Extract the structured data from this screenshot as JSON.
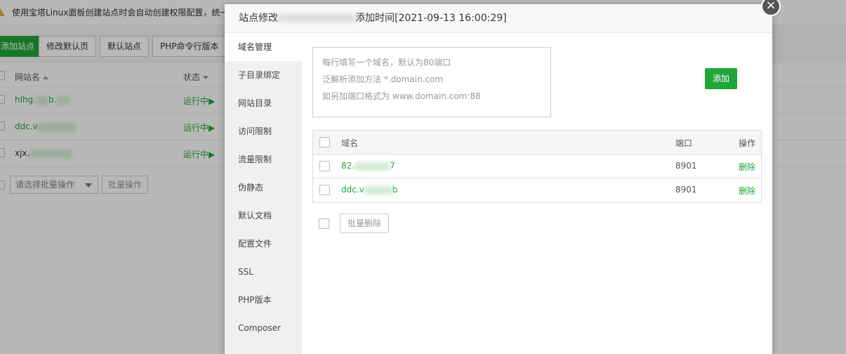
{
  "background": {
    "warning_text": "使用宝塔Linux面板创建站点时会自动创建权限配置，统一",
    "toolbar": {
      "add_site": "添加站点",
      "modify_default_page": "修改默认页",
      "default_site": "默认站点",
      "php_cli_version": "PHP命令行版本"
    },
    "table": {
      "col_name": "网站名",
      "col_status": "状态",
      "rows": [
        {
          "name_prefix": "hlhg.",
          "name_suffix": "b.",
          "status": "运行中▶"
        },
        {
          "name_prefix": "ddc.v",
          "name_suffix": "",
          "status": "运行中▶"
        },
        {
          "name_prefix": "xjx.",
          "name_suffix": "",
          "status": "运行中▶"
        }
      ]
    },
    "batch_select_placeholder": "请选择批量操作",
    "batch_button": "批量操作"
  },
  "modal": {
    "title_prefix": "站点修改",
    "title_suffix": "添加时间[2021-09-13 16:00:29]",
    "close_glyph": "×",
    "nav": [
      {
        "label": "域名管理",
        "active": true
      },
      {
        "label": "子目录绑定"
      },
      {
        "label": "网站目录"
      },
      {
        "label": "访问限制"
      },
      {
        "label": "流量限制"
      },
      {
        "label": "伪静态"
      },
      {
        "label": "默认文档"
      },
      {
        "label": "配置文件"
      },
      {
        "label": "SSL"
      },
      {
        "label": "PHP版本"
      },
      {
        "label": "Composer"
      }
    ],
    "domain_input": {
      "line1": "每行填写一个域名，默认为80端口",
      "line2": "泛解析添加方法 *.domain.com",
      "line3": "如另加端口格式为 www.domain.com:88"
    },
    "add_button": "添加",
    "table": {
      "col_domain": "域名",
      "col_port": "端口",
      "col_action": "操作",
      "rows": [
        {
          "domain_prefix": "82.",
          "domain_suffix": "7",
          "port": "8901",
          "action": "删除"
        },
        {
          "domain_prefix": "ddc.v",
          "domain_suffix": "b",
          "port": "8901",
          "action": "删除"
        }
      ]
    },
    "bulk_delete": "批量删除"
  },
  "colors": {
    "accent": "#20a53a",
    "warning": "#f0ad4e"
  }
}
